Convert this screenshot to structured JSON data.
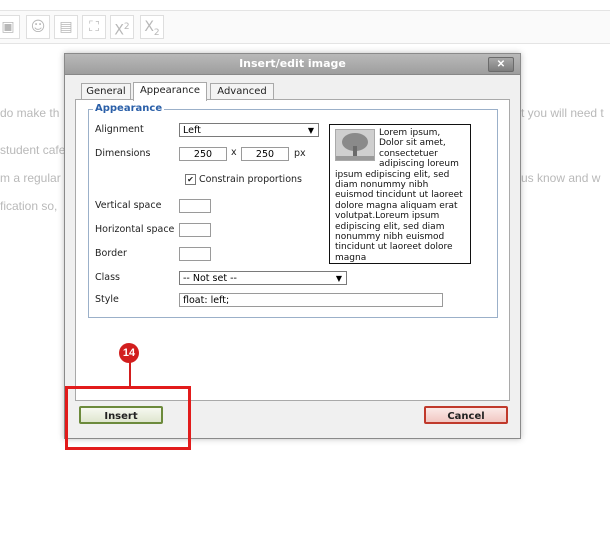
{
  "toolbar": {
    "buttons": [
      {
        "icon": "image-icon",
        "glyph": "▣"
      },
      {
        "icon": "smiley-icon",
        "glyph": "☺"
      },
      {
        "icon": "media-icon",
        "glyph": "▤"
      },
      {
        "icon": "template-icon",
        "glyph": "⛶"
      },
      {
        "icon": "superscript-icon",
        "base": "X",
        "mark": "2"
      },
      {
        "icon": "subscript-icon",
        "base": "X",
        "mark": "2"
      }
    ]
  },
  "background": {
    "left_lines": [
      "do make th",
      "student cafe",
      "m a regular",
      "fication so,"
    ],
    "right_lines": [
      "t you will need t",
      "us know and w"
    ]
  },
  "dialog": {
    "title": "Insert/edit image",
    "close_label": "✕",
    "tabs": [
      {
        "label": "General",
        "active": false
      },
      {
        "label": "Appearance",
        "active": true
      },
      {
        "label": "Advanced",
        "active": false
      }
    ],
    "fieldset_legend": "Appearance",
    "fields": {
      "alignment": {
        "label": "Alignment",
        "value": "Left"
      },
      "dimensions": {
        "label": "Dimensions",
        "width": "250",
        "separator": "x",
        "height": "250",
        "unit": "px"
      },
      "constrain": {
        "label": "Constrain proportions",
        "checked": true,
        "check_glyph": "✔"
      },
      "vertical_space": {
        "label": "Vertical space",
        "value": ""
      },
      "horizontal_space": {
        "label": "Horizontal space",
        "value": ""
      },
      "border": {
        "label": "Border",
        "value": ""
      },
      "class": {
        "label": "Class",
        "value": "-- Not set --"
      },
      "style": {
        "label": "Style",
        "value": "float: left;"
      }
    },
    "preview_text": "Lorem ipsum, Dolor sit amet, consectetuer adipiscing loreum ipsum edipiscing elit, sed diam nonummy nibh euismod tincidunt ut laoreet dolore magna aliquam erat volutpat.Loreum ipsum edipiscing elit, sed diam nonummy nibh euismod tincidunt ut laoreet dolore magna",
    "insert_label": "Insert",
    "cancel_label": "Cancel"
  },
  "annotation": {
    "step_number": "14",
    "color": "#d21e1e"
  }
}
